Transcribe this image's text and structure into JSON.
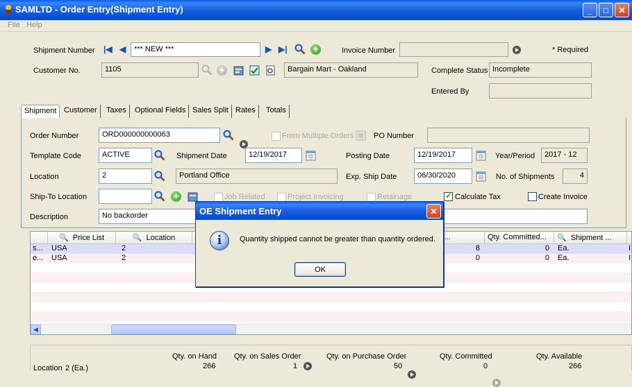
{
  "window": {
    "title": "SAMLTD - Order Entry(Shipment Entry)"
  },
  "menu": [
    "File",
    "Help"
  ],
  "header": {
    "shipment_number_label": "Shipment Number",
    "shipment_number_value": "*** NEW ***",
    "invoice_number_label": "Invoice Number",
    "invoice_number_value": "",
    "required_note": "* Required",
    "customer_no_label": "Customer No.",
    "customer_no_value": "1105",
    "customer_name": "Bargain Mart - Oakland",
    "complete_status_label": "Complete Status",
    "complete_status_value": "Incomplete",
    "entered_by_label": "Entered By",
    "entered_by_value": ""
  },
  "tabs": [
    {
      "label": "Shipment",
      "underline": "m"
    },
    {
      "label": "Customer",
      "underline": "C"
    },
    {
      "label": "Taxes",
      "underline": "x"
    },
    {
      "label": "Optional Fields",
      "underline": "F"
    },
    {
      "label": "Sales Split",
      "underline": "l"
    },
    {
      "label": "Rates",
      "underline": "R"
    },
    {
      "label": "Totals",
      "underline": "o"
    }
  ],
  "form": {
    "order_number_label": "Order Number",
    "order_number_value": "ORD000000000063",
    "from_multiple_orders_label": "From Multiple Orders",
    "po_number_label": "PO Number",
    "po_number_value": "",
    "template_code_label": "Template Code",
    "template_code_value": "ACTIVE",
    "shipment_date_label": "Shipment Date",
    "shipment_date_value": "12/19/2017",
    "posting_date_label": "Posting Date",
    "posting_date_value": "12/19/2017",
    "year_period_label": "Year/Period",
    "year_period_value": "2017 - 12",
    "location_label": "Location",
    "location_value": "2",
    "location_name": "Portland Office",
    "exp_ship_date_label": "Exp. Ship Date",
    "exp_ship_date_value": "06/30/2020",
    "no_of_shipments_label": "No. of Shipments",
    "no_of_shipments_value": "4",
    "ship_to_location_label": "Ship-To Location",
    "ship_to_location_value": "",
    "job_related_label": "Job Related",
    "project_invoicing_label": "Project Invoicing",
    "retainage_label": "Retainage",
    "calculate_tax_label": "Calculate Tax",
    "create_invoice_label": "Create Invoice",
    "description_label": "Description",
    "description_value": "No backorder"
  },
  "grid": {
    "headers": [
      "Price List",
      "Location",
      "d To Da...",
      "Qty. Committed...",
      "Shipment ..."
    ],
    "rows": [
      {
        "c0": "s...",
        "price_list": "USA",
        "location": "2",
        "to_date": "8",
        "committed": "0",
        "shipment": "Ea.",
        "tail": "I"
      },
      {
        "c0": "e...",
        "price_list": "USA",
        "location": "2",
        "to_date": "0",
        "committed": "0",
        "shipment": "Ea.",
        "tail": "I"
      }
    ]
  },
  "summary": {
    "location_label": "Location",
    "location_value": "2 (Ea.)",
    "qty_on_hand_label": "Qty. on Hand",
    "qty_on_hand_value": "266",
    "qty_on_sales_order_label": "Qty. on Sales Order",
    "qty_on_sales_order_value": "1",
    "qty_on_purchase_order_label": "Qty. on Purchase Order",
    "qty_on_purchase_order_value": "50",
    "qty_committed_label": "Qty. Committed",
    "qty_committed_value": "0",
    "qty_available_label": "Qty. Available",
    "qty_available_value": "266"
  },
  "dialog": {
    "title": "OE Shipment Entry",
    "message": "Quantity shipped cannot be greater than quantity ordered.",
    "ok_label": "OK"
  },
  "colors": {
    "titlebar": "#0a5fe4",
    "selected_row": "#dcdcff",
    "alt_row": "#fbf0f0"
  }
}
